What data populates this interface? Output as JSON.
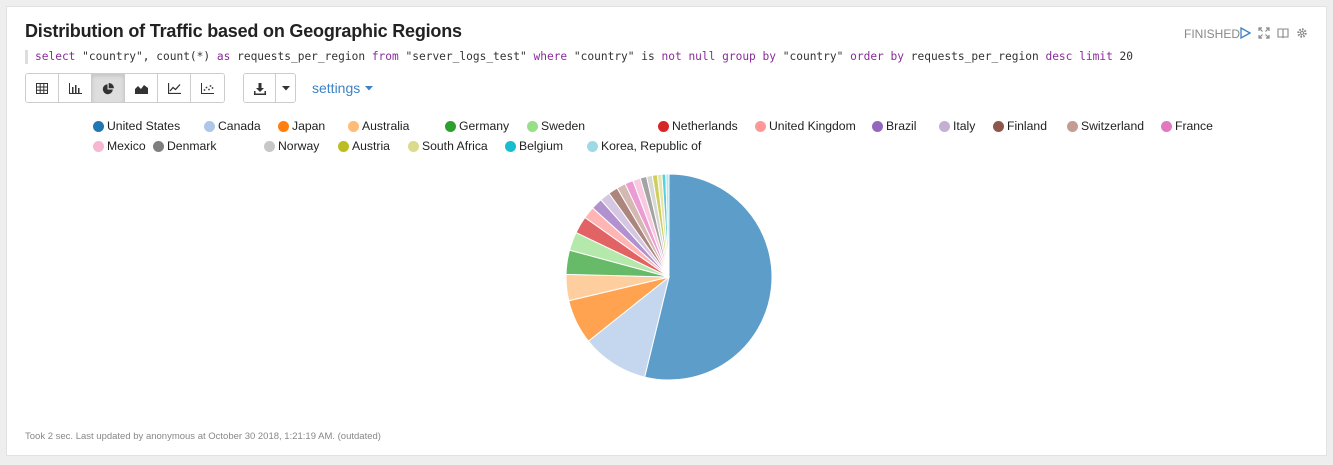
{
  "paragraph": {
    "title": "Distribution of Traffic based on Geographic Regions",
    "status": "FINISHED",
    "query": {
      "tokens": [
        {
          "t": "select",
          "k": true
        },
        {
          "t": " \"country\", count(*) ",
          "k": false
        },
        {
          "t": "as",
          "k": true
        },
        {
          "t": " requests_per_region ",
          "k": false
        },
        {
          "t": "from",
          "k": true
        },
        {
          "t": " \"server_logs_test\" ",
          "k": false
        },
        {
          "t": "where",
          "k": true
        },
        {
          "t": " \"country\" ",
          "k": false
        },
        {
          "t": "is",
          "k": false
        },
        {
          "t": " ",
          "k": false
        },
        {
          "t": "not null group by",
          "k": true
        },
        {
          "t": " \"country\" ",
          "k": false
        },
        {
          "t": "order by",
          "k": true
        },
        {
          "t": " requests_per_region ",
          "k": false
        },
        {
          "t": "desc limit",
          "k": true
        },
        {
          "t": " 20",
          "k": false
        }
      ]
    },
    "toolbar": {
      "view_buttons": [
        "table-icon",
        "bar-chart-icon",
        "pie-chart-icon",
        "area-chart-icon",
        "line-chart-icon",
        "scatter-chart-icon"
      ],
      "active_view": "pie-chart-icon",
      "settings_label": "settings"
    },
    "footer": "Took 2 sec. Last updated by anonymous at October 30 2018, 1:21:19 AM. (outdated)"
  },
  "chart_data": {
    "type": "pie",
    "title": "",
    "legend_position": "top",
    "categories": [
      "United States",
      "Canada",
      "Japan",
      "Australia",
      "Germany",
      "Sweden",
      "Netherlands",
      "United Kingdom",
      "Brazil",
      "Italy",
      "Finland",
      "Switzerland",
      "France",
      "Mexico",
      "Denmark",
      "Norway",
      "Austria",
      "South Africa",
      "Belgium",
      "Korea, Republic of"
    ],
    "values": [
      53.8,
      10.5,
      7.0,
      4.1,
      3.8,
      2.9,
      2.7,
      1.9,
      1.8,
      1.6,
      1.5,
      1.4,
      1.3,
      1.2,
      1.0,
      0.9,
      0.8,
      0.7,
      0.6,
      0.5
    ],
    "colors": [
      "#1f77b4",
      "#aec7e8",
      "#ff7f0e",
      "#ffbb78",
      "#2ca02c",
      "#98df8a",
      "#d62728",
      "#ff9896",
      "#9467bd",
      "#c5b0d5",
      "#8c564b",
      "#c49c94",
      "#e377c2",
      "#f7b6d2",
      "#7f7f7f",
      "#c7c7c7",
      "#bcbd22",
      "#dbdb8d",
      "#17becf",
      "#9edae5"
    ]
  }
}
